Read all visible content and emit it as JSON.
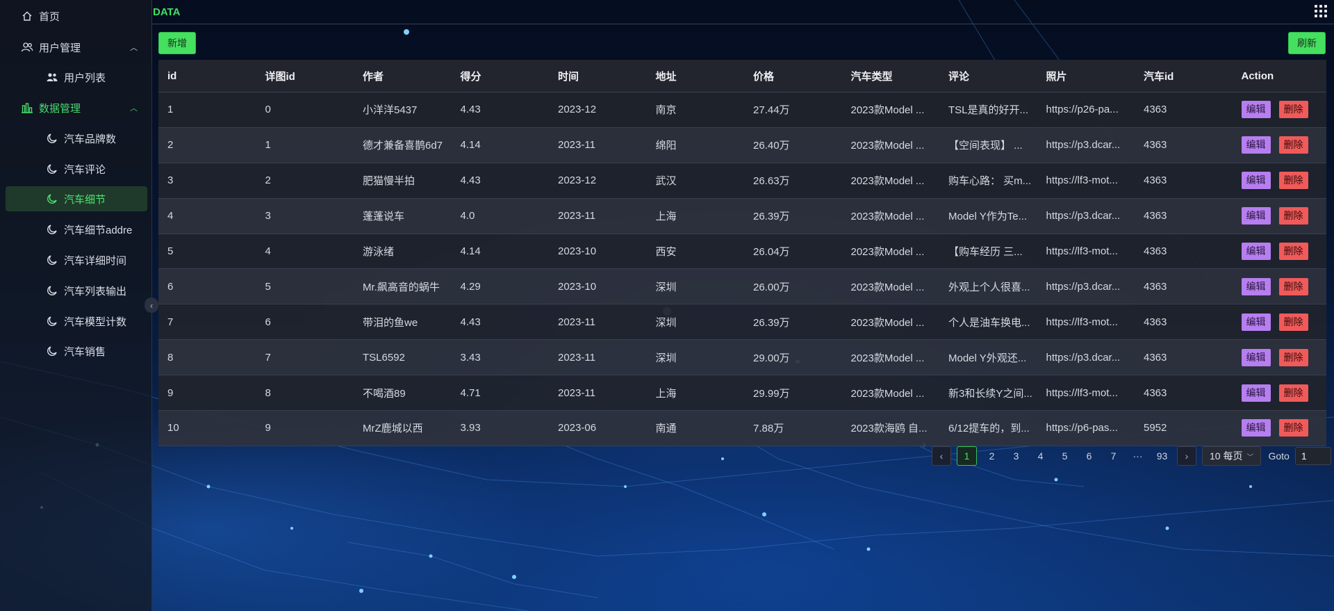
{
  "header": {
    "title": "DATA"
  },
  "sidebar": {
    "items": [
      {
        "label": "首页",
        "icon": "home-icon"
      },
      {
        "label": "用户管理",
        "icon": "users-icon"
      },
      {
        "label": "用户列表",
        "icon": "user-group-icon"
      },
      {
        "label": "数据管理",
        "icon": "bar-chart-icon"
      },
      {
        "label": "汽车品牌数",
        "icon": "moon-icon"
      },
      {
        "label": "汽车评论",
        "icon": "moon-icon"
      },
      {
        "label": "汽车细节",
        "icon": "moon-icon"
      },
      {
        "label": "汽车细节addre",
        "icon": "moon-icon"
      },
      {
        "label": "汽车详细时间",
        "icon": "moon-icon"
      },
      {
        "label": "汽车列表输出",
        "icon": "moon-icon"
      },
      {
        "label": "汽车模型计数",
        "icon": "moon-icon"
      },
      {
        "label": "汽车销售",
        "icon": "moon-icon"
      }
    ],
    "active_label": "汽车细节"
  },
  "toolbar": {
    "add_label": "新增",
    "refresh_label": "刷新"
  },
  "table": {
    "columns": [
      "id",
      "详图id",
      "作者",
      "得分",
      "时间",
      "地址",
      "价格",
      "汽车类型",
      "评论",
      "照片",
      "汽车id",
      "Action"
    ],
    "rows": [
      [
        "1",
        "0",
        "小洋洋5437",
        "4.43",
        "2023-12",
        "南京",
        "27.44万",
        "2023款Model ...",
        "TSL是真的好开...",
        "https://p26-pa...",
        "4363"
      ],
      [
        "2",
        "1",
        "德才兼备喜鹊6d7",
        "4.14",
        "2023-11",
        "绵阳",
        "26.40万",
        "2023款Model ...",
        "【空间表现】 ...",
        "https://p3.dcar...",
        "4363"
      ],
      [
        "3",
        "2",
        "肥猫慢半拍",
        "4.43",
        "2023-12",
        "武汉",
        "26.63万",
        "2023款Model ...",
        "购车心路： 买m...",
        "https://lf3-mot...",
        "4363"
      ],
      [
        "4",
        "3",
        "蓬蓬说车",
        "4.0",
        "2023-11",
        "上海",
        "26.39万",
        "2023款Model ...",
        "Model Y作为Te...",
        "https://p3.dcar...",
        "4363"
      ],
      [
        "5",
        "4",
        "游泳绪",
        "4.14",
        "2023-10",
        "西安",
        "26.04万",
        "2023款Model ...",
        "【购车经历 三...",
        "https://lf3-mot...",
        "4363"
      ],
      [
        "6",
        "5",
        "Mr.飙高音的蜗牛",
        "4.29",
        "2023-10",
        "深圳",
        "26.00万",
        "2023款Model ...",
        "外观上个人很喜...",
        "https://p3.dcar...",
        "4363"
      ],
      [
        "7",
        "6",
        "带泪的鱼we",
        "4.43",
        "2023-11",
        "深圳",
        "26.39万",
        "2023款Model ...",
        "个人是油车换电...",
        "https://lf3-mot...",
        "4363"
      ],
      [
        "8",
        "7",
        "TSL6592",
        "3.43",
        "2023-11",
        "深圳",
        "29.00万",
        "2023款Model ...",
        "Model Y外观还...",
        "https://p3.dcar...",
        "4363"
      ],
      [
        "9",
        "8",
        "不喝酒89",
        "4.71",
        "2023-11",
        "上海",
        "29.99万",
        "2023款Model ...",
        "新3和长续Y之间...",
        "https://lf3-mot...",
        "4363"
      ],
      [
        "10",
        "9",
        "MrZ鹿城以西",
        "3.93",
        "2023-06",
        "南通",
        "7.88万",
        "2023款海鸥 自...",
        "6/12提车的，到...",
        "https://p6-pas...",
        "5952"
      ]
    ],
    "edit_label": "编辑",
    "delete_label": "删除"
  },
  "pagination": {
    "prev_icon": "chevron-left-icon",
    "pages": [
      "1",
      "2",
      "3",
      "4",
      "5",
      "6",
      "7",
      "···",
      "93"
    ],
    "current": "1",
    "next_icon": "chevron-right-icon",
    "page_size": "10 每页",
    "goto_label": "Goto",
    "goto_value": "1"
  },
  "colors": {
    "accent": "#45e05f",
    "edit": "#b67ef0",
    "delete": "#f05a5a"
  }
}
